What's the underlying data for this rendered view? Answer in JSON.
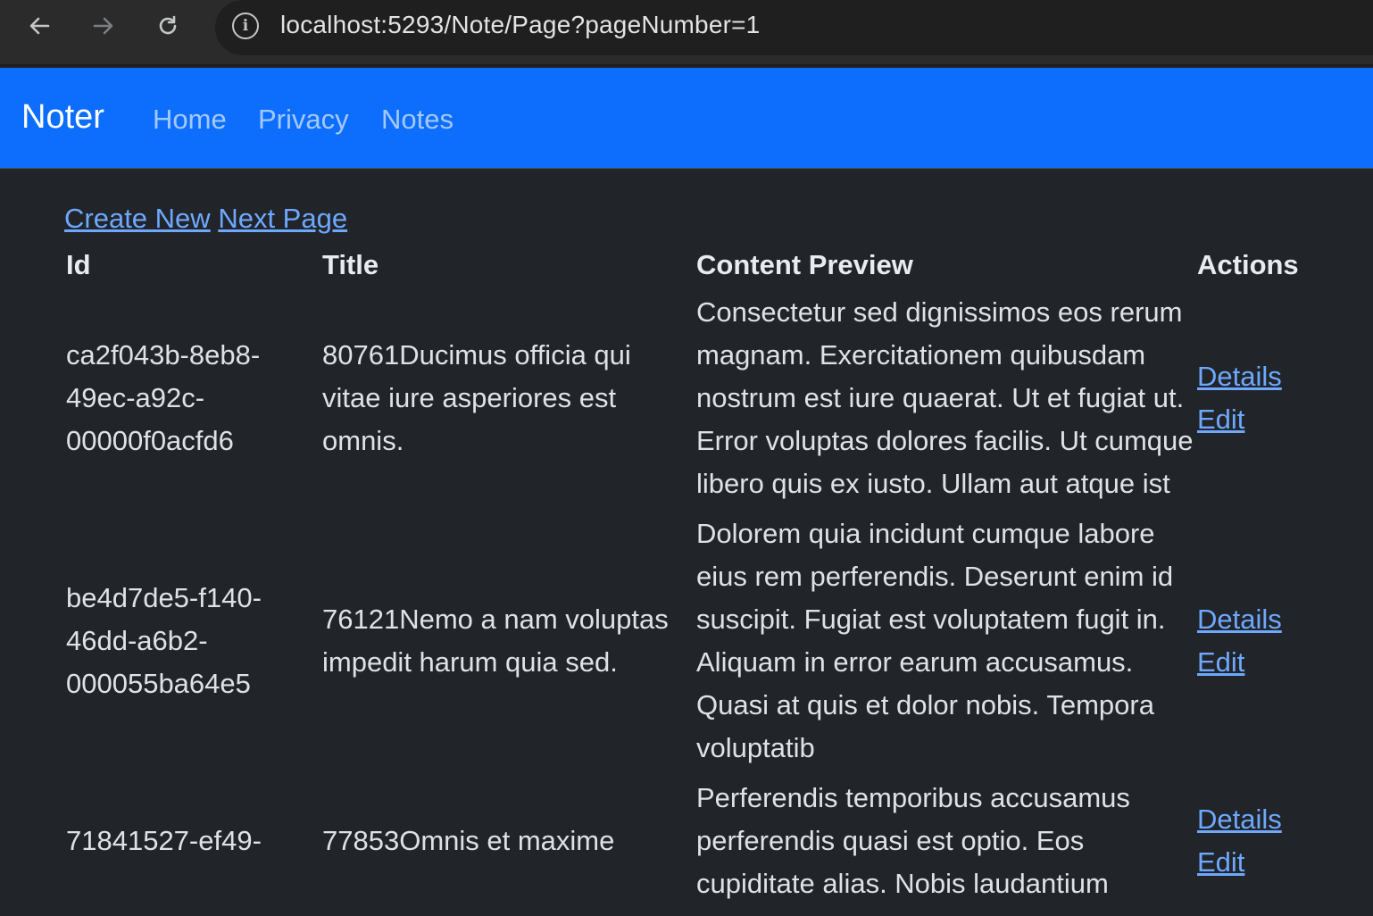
{
  "browser": {
    "url": "localhost:5293/Note/Page?pageNumber=1",
    "back_icon": "←",
    "forward_icon": "→",
    "reload_icon": "↻",
    "info_icon": "i"
  },
  "navbar": {
    "brand": "Noter",
    "links": [
      "Home",
      "Privacy",
      "Notes"
    ],
    "color": "#0d6efd"
  },
  "page": {
    "create_new": "Create New",
    "next_page": "Next Page"
  },
  "table": {
    "headers": [
      "Id",
      "Title",
      "Content Preview",
      "Actions"
    ],
    "rows": [
      {
        "id": "ca2f043b-8eb8-49ec-a92c-00000f0acfd6",
        "title": "80761Ducimus officia qui vitae iure asperiores est omnis.",
        "content": "Consectetur sed dignissimos eos rerum magnam. Exercitationem quibusdam nostrum est iure quaerat. Ut et fugiat ut. Error voluptas dolores facilis. Ut cumque libero quis ex iusto. Ullam aut atque ist",
        "details": "Details",
        "edit": "Edit"
      },
      {
        "id": "be4d7de5-f140-46dd-a6b2-000055ba64e5",
        "title": "76121Nemo a nam voluptas impedit harum quia sed.",
        "content": "Dolorem quia incidunt cumque labore eius rem perferendis. Deserunt enim id suscipit. Fugiat est voluptatem fugit in. Aliquam in error earum accusamus. Quasi at quis et dolor nobis. Tempora voluptatib",
        "details": "Details",
        "edit": "Edit"
      },
      {
        "id": "71841527-ef49-",
        "title": "77853Omnis et maxime",
        "content": "Perferendis temporibus accusamus perferendis quasi est optio. Eos cupiditate alias. Nobis laudantium",
        "details": "Details",
        "edit": "Edit"
      }
    ]
  }
}
